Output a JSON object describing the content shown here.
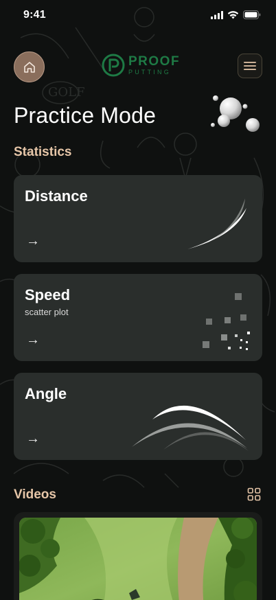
{
  "status_bar": {
    "time": "9:41",
    "icons": [
      "signal-icon",
      "wifi-icon",
      "battery-icon"
    ]
  },
  "header": {
    "home_icon": "home-icon",
    "logo": {
      "word1": "PROOF",
      "word2": "PUTTING"
    },
    "menu_icon": "menu-icon"
  },
  "page_title": "Practice Mode",
  "statistics": {
    "label": "Statistics",
    "cards": [
      {
        "title": "Distance",
        "subtitle": "",
        "arrow": "→"
      },
      {
        "title": "Speed",
        "subtitle": "scatter plot",
        "arrow": "→"
      },
      {
        "title": "Angle",
        "subtitle": "",
        "arrow": "→"
      }
    ]
  },
  "videos": {
    "label": "Videos",
    "grid_icon": "grid-icon"
  },
  "colors": {
    "background": "#0f1110",
    "card": "#2a2e2c",
    "accent_label": "#e6c6a8",
    "logo_green": "#1e7a45",
    "home_button": "#8a6e5c"
  }
}
